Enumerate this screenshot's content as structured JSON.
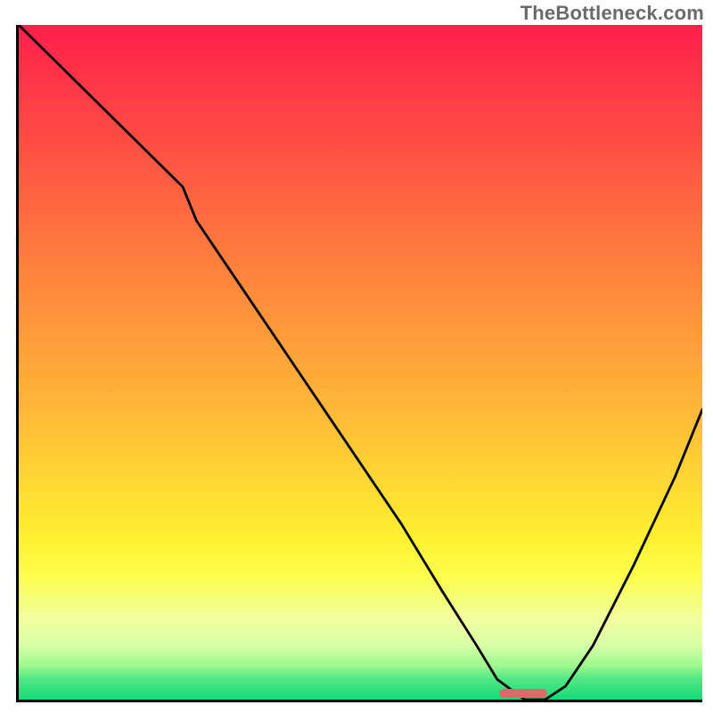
{
  "watermark": "TheBottleneck.com",
  "colors": {
    "curve": "#000000",
    "marker": "#dd6a6a",
    "axis": "#000000"
  },
  "chart_data": {
    "type": "line",
    "title": "",
    "xlabel": "",
    "ylabel": "",
    "xlim": [
      0,
      100
    ],
    "ylim": [
      0,
      100
    ],
    "x": [
      0,
      8,
      16,
      24,
      26,
      32,
      40,
      48,
      56,
      62,
      67,
      70,
      74,
      77,
      80,
      84,
      90,
      96,
      100
    ],
    "y": [
      100,
      92,
      84,
      76,
      71,
      62,
      50,
      38,
      26,
      16,
      8,
      3,
      0,
      0,
      2,
      8,
      20,
      33,
      43
    ],
    "marker_range_x": [
      70,
      77
    ],
    "notes": "V-shaped bottleneck curve; y read as % of plot height from bottom; minimum (optimal) around x≈72–76 at y≈0. Values estimated from unlabeled axes."
  }
}
